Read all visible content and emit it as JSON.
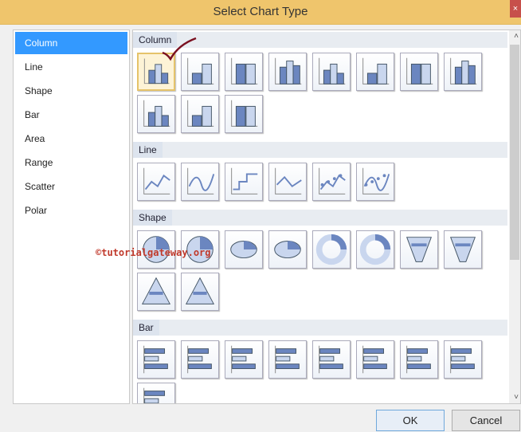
{
  "dialog": {
    "title": "Select Chart Type",
    "close": "×"
  },
  "categories": [
    {
      "label": "Column",
      "selected": true
    },
    {
      "label": "Line"
    },
    {
      "label": "Shape"
    },
    {
      "label": "Bar"
    },
    {
      "label": "Area"
    },
    {
      "label": "Range"
    },
    {
      "label": "Scatter"
    },
    {
      "label": "Polar"
    }
  ],
  "sections": [
    {
      "label": "Column",
      "kind": "column",
      "icons": [
        "column",
        "stacked-column",
        "100-stacked-column",
        "3d-clustered-column",
        "3d-stacked-column",
        "3d-100-stacked-column",
        "3d-column",
        "cylinder",
        "stacked-cylinder",
        "100-stacked-cylinder",
        "3d-cylinder"
      ]
    },
    {
      "label": "Line",
      "kind": "line",
      "icons": [
        "line",
        "smooth-line",
        "stepped-line",
        "3d-line",
        "line-with-markers",
        "smooth-line-with-markers"
      ]
    },
    {
      "label": "Shape",
      "kind": "shape",
      "icons": [
        "pie",
        "exploded-pie",
        "3d-pie",
        "3d-exploded-pie",
        "doughnut",
        "exploded-doughnut",
        "funnel",
        "3d-funnel",
        "pyramid",
        "3d-pyramid"
      ]
    },
    {
      "label": "Bar",
      "kind": "bar",
      "icons": [
        "bar",
        "stacked-bar",
        "100-stacked-bar",
        "3d-clustered-bar",
        "3d-stacked-bar",
        "3d-100-stacked-bar",
        "3d-cylinder-bar",
        "stacked-cylinder-bar",
        "100-stacked-cylinder-bar"
      ]
    }
  ],
  "watermark": "©tutorialgateway.org",
  "buttons": {
    "ok": "OK",
    "cancel": "Cancel"
  },
  "colors": {
    "titlebar": "#efc56c",
    "selection": "#3399ff",
    "watermark": "#c0392b"
  }
}
